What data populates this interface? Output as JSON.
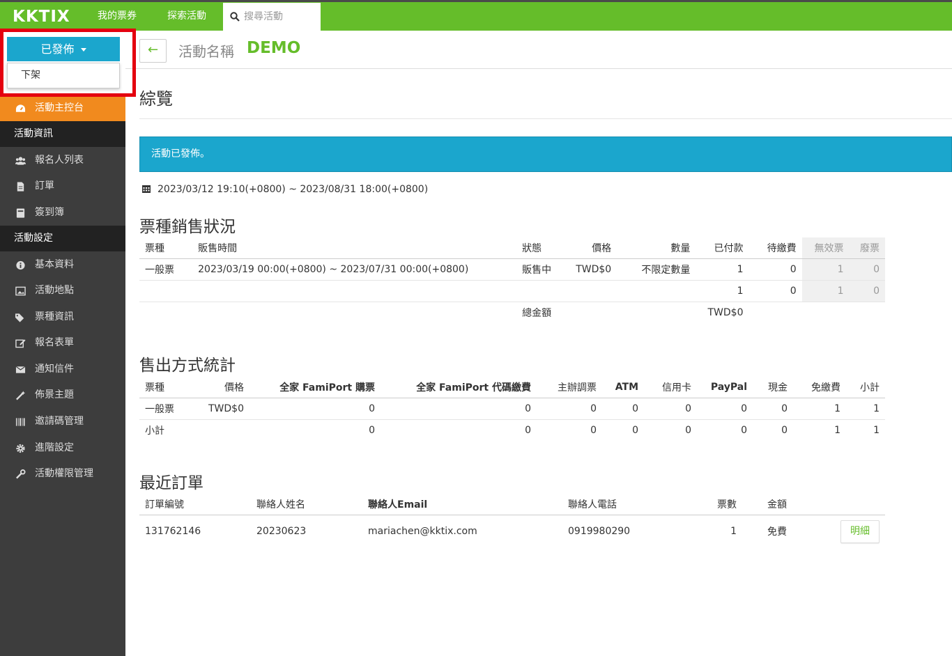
{
  "topbar": {
    "logo": "KKTIX",
    "nav": [
      "我的票券",
      "探索活動"
    ],
    "search_placeholder": "搜尋活動"
  },
  "sidebar": {
    "status_button": "已發佈",
    "dropdown_item": "下架",
    "dashboard": "活動主控台",
    "section_info": "活動資訊",
    "info_items": [
      "報名人列表",
      "訂單",
      "簽到簿"
    ],
    "section_settings": "活動設定",
    "settings_items": [
      "基本資料",
      "活動地點",
      "票種資訊",
      "報名表單",
      "通知信件",
      "佈景主題",
      "邀請碼管理",
      "進階設定",
      "活動權限管理"
    ]
  },
  "header": {
    "back": "←",
    "event_label": "活動名稱",
    "event_name": "DEMO"
  },
  "overview": {
    "title": "綜覽",
    "alert": "活動已發佈。",
    "dates": "2023/03/12 19:10(+0800) ~ 2023/08/31 18:00(+0800)"
  },
  "ticket_sales": {
    "title": "票種銷售狀況",
    "headers": [
      "票種",
      "販售時間",
      "狀態",
      "價格",
      "數量",
      "已付款",
      "待繳費",
      "無效票",
      "廢票"
    ],
    "row": [
      "一般票",
      "2023/03/19 00:00(+0800) ~ 2023/07/31 00:00(+0800)",
      "販售中",
      "TWD$0",
      "不限定數量",
      "1",
      "0",
      "1",
      "0"
    ],
    "totals": [
      "1",
      "0",
      "1",
      "0"
    ],
    "total_label": "總金額",
    "total_amount": "TWD$0"
  },
  "sales_method": {
    "title": "售出方式統計",
    "headers": [
      "票種",
      "價格",
      "全家 FamiPort 購票",
      "全家 FamiPort 代碼繳費",
      "主辦調票",
      "ATM",
      "信用卡",
      "PayPal",
      "現金",
      "免繳費",
      "小計"
    ],
    "rows": [
      [
        "一般票",
        "TWD$0",
        "0",
        "0",
        "0",
        "0",
        "0",
        "0",
        "0",
        "1",
        "1"
      ],
      [
        "小計",
        "",
        "0",
        "0",
        "0",
        "0",
        "0",
        "0",
        "0",
        "1",
        "1"
      ]
    ]
  },
  "recent_orders": {
    "title": "最近訂單",
    "headers": [
      "訂單編號",
      "聯絡人姓名",
      "聯絡人Email",
      "聯絡人電話",
      "票數",
      "金額"
    ],
    "row": [
      "131762146",
      "20230623",
      "mariachen@kktix.com",
      "0919980290",
      "1",
      "免費"
    ],
    "detail_button": "明細"
  },
  "colors": {
    "brand_green": "#65bd2a",
    "info_blue": "#1ba6cd",
    "dashboard_orange": "#f18a1e",
    "highlight_red": "#e4000f",
    "sidebar_dark": "#3d3d3d"
  }
}
